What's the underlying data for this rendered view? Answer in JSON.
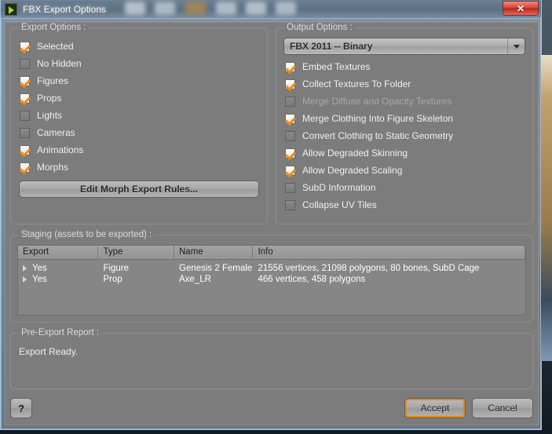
{
  "window": {
    "title": "FBX Export Options",
    "icon": "daz-studio-icon",
    "close_label": "✕"
  },
  "export_options": {
    "legend": "Export Options :",
    "items": [
      {
        "label": "Selected",
        "checked": true,
        "enabled": true
      },
      {
        "label": "No Hidden",
        "checked": false,
        "enabled": true
      },
      {
        "label": "Figures",
        "checked": true,
        "enabled": true
      },
      {
        "label": "Props",
        "checked": true,
        "enabled": true
      },
      {
        "label": "Lights",
        "checked": false,
        "enabled": true
      },
      {
        "label": "Cameras",
        "checked": false,
        "enabled": true
      },
      {
        "label": "Animations",
        "checked": true,
        "enabled": true
      },
      {
        "label": "Morphs",
        "checked": true,
        "enabled": true
      }
    ],
    "morph_button": "Edit Morph Export Rules..."
  },
  "output_options": {
    "legend": "Output Options :",
    "format": {
      "selected": "FBX 2011 -- Binary",
      "arrow_icon": "chevron-down-icon"
    },
    "items": [
      {
        "label": "Embed Textures",
        "checked": true,
        "enabled": true
      },
      {
        "label": "Collect Textures To Folder",
        "checked": true,
        "enabled": true
      },
      {
        "label": "Merge Diffuse and Opacity Textures",
        "checked": false,
        "enabled": false
      },
      {
        "label": "Merge Clothing Into Figure Skeleton",
        "checked": true,
        "enabled": true
      },
      {
        "label": "Convert Clothing to Static Geometry",
        "checked": false,
        "enabled": true
      },
      {
        "label": "Allow Degraded Skinning",
        "checked": true,
        "enabled": true
      },
      {
        "label": "Allow Degraded Scaling",
        "checked": true,
        "enabled": true
      },
      {
        "label": "SubD Information",
        "checked": false,
        "enabled": true
      },
      {
        "label": "Collapse UV Tiles",
        "checked": false,
        "enabled": true
      }
    ]
  },
  "staging": {
    "legend": "Staging (assets to be exported) :",
    "columns": [
      "Export",
      "Type",
      "Name",
      "Info"
    ],
    "rows": [
      {
        "export": "Yes",
        "type": "Figure",
        "name": "Genesis 2 Female",
        "info": "21556 vertices, 21098 polygons, 80 bones, SubD Cage"
      },
      {
        "export": "Yes",
        "type": "Prop",
        "name": "Axe_LR",
        "info": "466 vertices, 458 polygons"
      }
    ]
  },
  "report": {
    "legend": "Pre-Export Report :",
    "text": "Export Ready."
  },
  "footer": {
    "help_label": "?",
    "accept_label": "Accept",
    "cancel_label": "Cancel"
  },
  "colors": {
    "check_orange": "#ef8b13",
    "dialog_gray": "#7c7c7c",
    "focus_orange": "#e08a18",
    "close_red": "#d8473a"
  }
}
